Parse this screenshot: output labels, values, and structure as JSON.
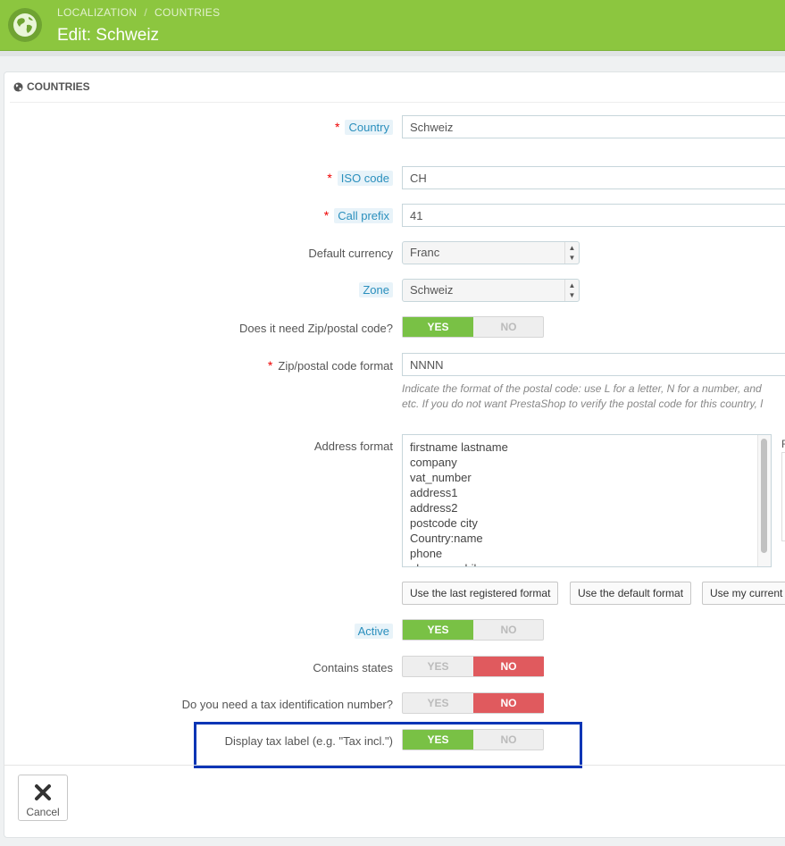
{
  "header": {
    "breadcrumb": [
      "LOCALIZATION",
      "COUNTRIES"
    ],
    "title": "Edit: Schweiz"
  },
  "panel": {
    "heading": "COUNTRIES"
  },
  "form": {
    "country": {
      "label": "Country",
      "value": "Schweiz"
    },
    "iso_code": {
      "label": "ISO code",
      "value": "CH"
    },
    "call_prefix": {
      "label": "Call prefix",
      "value": "41"
    },
    "default_currency": {
      "label": "Default currency",
      "value": "Franc"
    },
    "zone": {
      "label": "Zone",
      "value": "Schweiz"
    },
    "need_zip": {
      "label": "Does it need Zip/postal code?",
      "yes": "YES",
      "no": "NO",
      "value": "YES"
    },
    "zip_format": {
      "label": "Zip/postal code format",
      "value": "NNNN",
      "help_line1": "Indicate the format of the postal code: use L for a letter, N for a number, and",
      "help_line2": "etc. If you do not want PrestaShop to verify the postal code for this country, l"
    },
    "address_format": {
      "label": "Address format",
      "lines": [
        "firstname lastname",
        "company",
        "vat_number",
        "address1",
        "address2",
        "postcode city",
        "Country:name",
        "phone",
        "phone_mobile"
      ],
      "side_letter": "F"
    },
    "format_buttons": [
      "Use the last registered format",
      "Use the default format",
      "Use my current"
    ],
    "active": {
      "label": "Active",
      "yes": "YES",
      "no": "NO",
      "value": "YES"
    },
    "contains_states": {
      "label": "Contains states",
      "yes": "YES",
      "no": "NO",
      "value": "NO"
    },
    "need_tax_id": {
      "label": "Do you need a tax identification number?",
      "yes": "YES",
      "no": "NO",
      "value": "NO"
    },
    "display_tax_label": {
      "label": "Display tax label (e.g. \"Tax incl.\")",
      "yes": "YES",
      "no": "NO",
      "value": "YES"
    }
  },
  "footer": {
    "cancel": "Cancel"
  },
  "colors": {
    "header": "#8cc63f",
    "yes_on": "#79c145",
    "no_on": "#e05a5e",
    "highlight": "#0a35b5",
    "hint_text": "#2a8fbd"
  }
}
